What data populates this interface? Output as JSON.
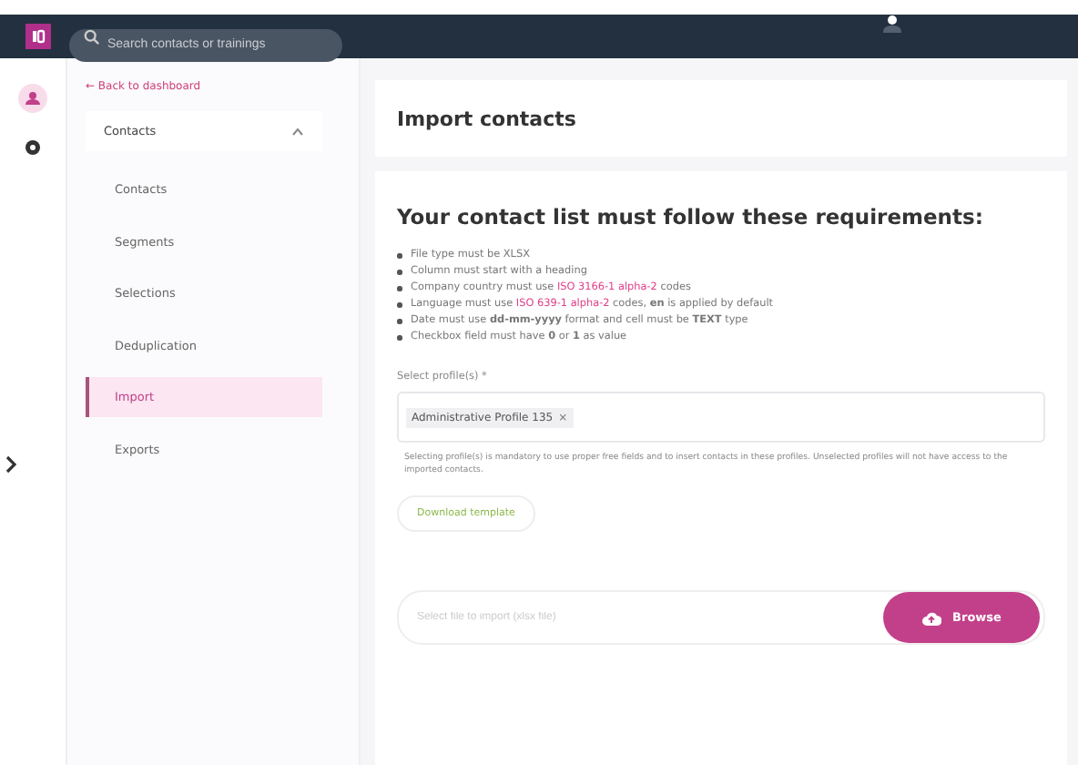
{
  "topbar": {
    "search_placeholder": "Search contacts or trainings"
  },
  "sidebar": {
    "back_link": "← Back to dashboard",
    "section": {
      "label": "Contacts",
      "expanded": true
    },
    "items": [
      {
        "label": "Contacts",
        "selected": false
      },
      {
        "label": "Segments",
        "selected": false
      },
      {
        "label": "Selections",
        "selected": false
      },
      {
        "label": "Deduplication",
        "selected": false
      },
      {
        "label": "Import",
        "selected": true
      },
      {
        "label": "Exports",
        "selected": false
      }
    ]
  },
  "page_title": "Import contacts",
  "requirements": {
    "title": "Your contact list must follow these requirements:",
    "items": [
      [
        {
          "kind": "text",
          "text": "File type must be XLSX"
        }
      ],
      [
        {
          "kind": "text",
          "text": "Column must start with a heading"
        }
      ],
      [
        {
          "kind": "text",
          "text": "Company country must use "
        },
        {
          "kind": "link",
          "text": "ISO 3166-1 alpha-2"
        },
        {
          "kind": "text",
          "text": " codes"
        }
      ],
      [
        {
          "kind": "text",
          "text": "Language must use "
        },
        {
          "kind": "link",
          "text": "ISO 639-1 alpha-2"
        },
        {
          "kind": "text",
          "text": " codes, **en** is applied by default"
        }
      ],
      [
        {
          "kind": "text",
          "text": "Date must use **dd-mm-yyyy** format and cell must be **TEXT** type"
        }
      ],
      [
        {
          "kind": "text",
          "text": "Checkbox field must have **0** or **1** as value"
        }
      ]
    ]
  },
  "profiles": {
    "label": "Select profile(s) *",
    "tags": [
      {
        "label": "Administrative Profile 135",
        "remove": "×"
      }
    ],
    "help": "Selecting profile(s) is mandatory to use proper free fields and to insert contacts in these profiles. Unselected profiles will not have access to the imported contacts."
  },
  "download_button": "Download template",
  "file": {
    "placeholder": "Select file to import (xlsx file)",
    "button": "Browse"
  }
}
